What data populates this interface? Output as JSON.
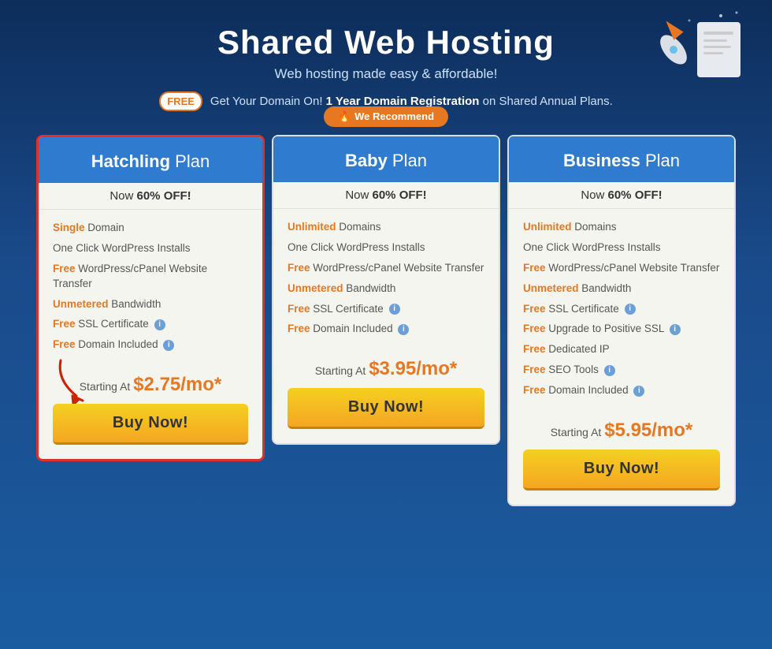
{
  "header": {
    "title": "Shared Web Hosting",
    "subtitle": "Web hosting made easy & affordable!",
    "free_badge": "FREE",
    "promo_text": " Get Your Domain On! ",
    "promo_highlight": "1 Year Domain Registration",
    "promo_suffix": " on Shared Annual Plans."
  },
  "plans": [
    {
      "id": "hatchling",
      "name_bold": "Hatchling",
      "name_rest": " Plan",
      "discount": "Now ",
      "discount_bold": "60% OFF!",
      "features": [
        {
          "highlight": "Single",
          "rest": " Domain"
        },
        {
          "highlight": "",
          "rest": "One Click WordPress Installs"
        },
        {
          "highlight": "Free",
          "rest": " WordPress/cPanel Website Transfer"
        },
        {
          "highlight": "Unmetered",
          "rest": " Bandwidth"
        },
        {
          "highlight": "Free",
          "rest": " SSL Certificate",
          "info": true
        },
        {
          "highlight": "Free",
          "rest": " Domain Included",
          "info": true
        }
      ],
      "starting_at": "Starting At",
      "price": "$2.75/mo*",
      "buy_label": "Buy Now!",
      "recommended": false,
      "highlight_border": true
    },
    {
      "id": "baby",
      "name_bold": "Baby",
      "name_rest": " Plan",
      "discount": "Now ",
      "discount_bold": "60% OFF!",
      "features": [
        {
          "highlight": "Unlimited",
          "rest": " Domains"
        },
        {
          "highlight": "",
          "rest": "One Click WordPress Installs"
        },
        {
          "highlight": "Free",
          "rest": " WordPress/cPanel Website Transfer"
        },
        {
          "highlight": "Unmetered",
          "rest": " Bandwidth"
        },
        {
          "highlight": "Free",
          "rest": " SSL Certificate",
          "info": true
        },
        {
          "highlight": "Free",
          "rest": " Domain Included",
          "info": true
        }
      ],
      "starting_at": "Starting At",
      "price": "$3.95/mo*",
      "buy_label": "Buy Now!",
      "recommended": true,
      "recommend_label": "We Recommend"
    },
    {
      "id": "business",
      "name_bold": "Business",
      "name_rest": " Plan",
      "discount": "Now ",
      "discount_bold": "60% OFF!",
      "features": [
        {
          "highlight": "Unlimited",
          "rest": " Domains"
        },
        {
          "highlight": "",
          "rest": "One Click WordPress Installs"
        },
        {
          "highlight": "Free",
          "rest": " WordPress/cPanel Website Transfer"
        },
        {
          "highlight": "Unmetered",
          "rest": " Bandwidth"
        },
        {
          "highlight": "Free",
          "rest": " SSL Certificate",
          "info": true
        },
        {
          "highlight": "Free",
          "rest": " Upgrade to Positive SSL",
          "info": true
        },
        {
          "highlight": "Free",
          "rest": " Dedicated IP"
        },
        {
          "highlight": "Free",
          "rest": " SEO Tools",
          "info": true
        },
        {
          "highlight": "Free",
          "rest": " Domain Included",
          "info": true
        }
      ],
      "starting_at": "Starting At",
      "price": "$5.95/mo*",
      "buy_label": "Buy Now!",
      "recommended": false
    }
  ]
}
